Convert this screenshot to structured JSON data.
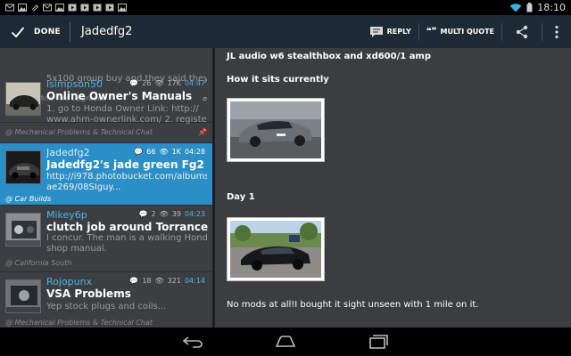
{
  "status_bar": {
    "clock": "18:10"
  },
  "action_bar": {
    "done_label": "DONE",
    "title": "Jadedfg2",
    "reply_label": "REPLY",
    "multi_quote_label": "MULTI QUOTE"
  },
  "threads": [
    {
      "snippet": "5x100 group buy and they said they...",
      "forum": "@ Wheel And Tire Upgrades"
    },
    {
      "author": "lsimpson50",
      "replies": "26",
      "views": "17K",
      "time": "04:47",
      "title": "Online Owner's Manuals",
      "snippet_1": "1. go to Honda Owner Link: http://",
      "snippet_2": "www.ahm-ownerlink.com/ 2. registe...",
      "forum": "@ Mechanical Problems & Technical Chat"
    },
    {
      "author": "Jadedfg2",
      "replies": "66",
      "views": "1K",
      "time": "04:28",
      "title": "Jadedfg2's jade green Fg2",
      "snippet_1": "http://i978.photobucket.com/albums/",
      "snippet_2": "ae269/08SIguy...",
      "forum": "@ Car Builds"
    },
    {
      "author": "Mikey6p",
      "replies": "2",
      "views": "39",
      "time": "04:23",
      "title": "clutch job around Torrance",
      "snippet_1": "I concur. The man is a walking Honda",
      "snippet_2": "shop manual.",
      "forum": "@ California South"
    },
    {
      "author": "Rojopunx",
      "replies": "18",
      "views": "321",
      "time": "04:14",
      "title": "VSA Problems",
      "snippet_1": "Yep stock plugs and coils...",
      "forum": "@ Mechanical Problems & Technical Chat"
    }
  ],
  "post": {
    "line_1": "JL audio w6 stealthbox and xd600/1 amp",
    "line_2": "How it sits currently",
    "line_3": "Day 1",
    "line_4": "No mods at all!I bought it sight unseen with 1 mile on it."
  },
  "colors": {
    "selected_row": "#2b8ec6",
    "action_bar": "#1d2a33",
    "author_link": "#4fb3e8"
  }
}
